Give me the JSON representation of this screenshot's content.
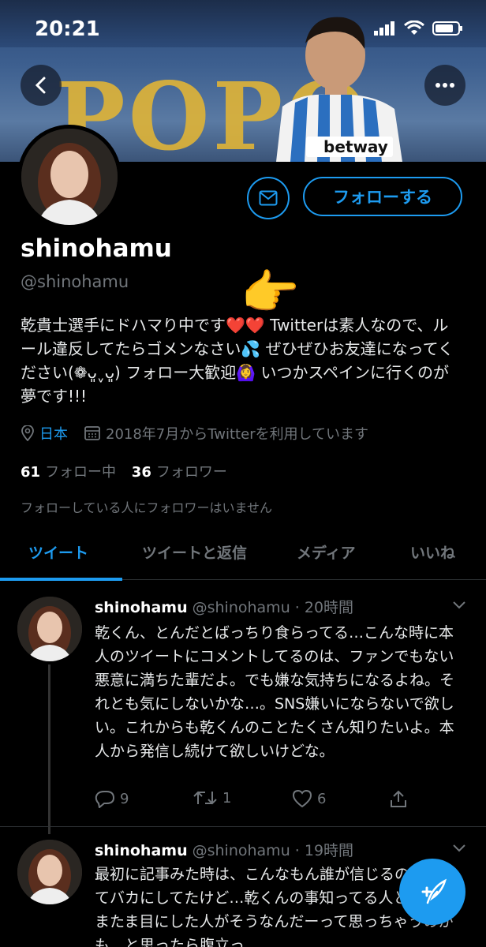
{
  "status_bar": {
    "time": "20:21"
  },
  "banner": {
    "letters": "POPO",
    "jersey_text": "betway"
  },
  "profile": {
    "display_name": "shinohamu",
    "handle": "@shinohamu",
    "follow_label": "フォローする",
    "bio": "乾貴士選手にドハマり中です❤️❤️ Twitterは素人なので、ルール違反してたらゴメンなさい💦 ぜひぜひお友達になってください(❁ᴗ͈ˬᴗ͈) フォロー大歓迎🙆‍♀️ いつかスペインに行くのが夢です!!!",
    "location": "日本",
    "joined": "2018年7月からTwitterを利用しています",
    "following_count": "61",
    "following_label": "フォロー中",
    "followers_count": "36",
    "followers_label": "フォロワー",
    "no_followers_known": "フォローしている人にフォロワーはいません"
  },
  "tabs": [
    {
      "label": "ツイート"
    },
    {
      "label": "ツイートと返信"
    },
    {
      "label": "メディア"
    },
    {
      "label": "いいね"
    }
  ],
  "tweets": [
    {
      "name": "shinohamu",
      "handle": "@shinohamu",
      "time": "· 20時間",
      "text": "乾くん、とんだとばっちり食らってる…こんな時に本人のツイートにコメントしてるのは、ファンでもない悪意に満ちた輩だよ。でも嫌な気持ちになるよね。それとも気にしないかな…。SNS嫌いにならないで欲しい。これからも乾くんのことたくさん知りたいよ。本人から発信し続けて欲しいけどな。",
      "replies": "9",
      "retweets": "1",
      "likes": "6"
    },
    {
      "name": "shinohamu",
      "handle": "@shinohamu",
      "time": "· 19時間",
      "text": "最初に記事みた時は、こんなもん誰が信じるの？！ってバカにしてたけど…乾くんの事知ってる人とか、たまたま目にした人がそうなんだーって思っちゃうのかも…と思ったら腹立っ"
    }
  ],
  "colors": {
    "accent": "#1d9bf0",
    "muted": "#71767b",
    "background": "#000000"
  }
}
